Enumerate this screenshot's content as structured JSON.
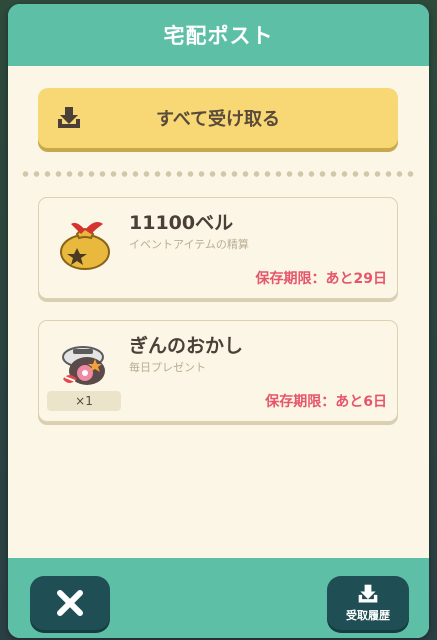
{
  "header": {
    "title": "宅配ポスト"
  },
  "receive_all": {
    "label": "すべて受け取る",
    "icon": "download-tray-icon"
  },
  "items": [
    {
      "name": "11100ベル",
      "subtitle": "イベントアイテムの精算",
      "expiry": "保存期限：あと29日",
      "icon": "bell-bag-icon"
    },
    {
      "name": "ぎんのおかし",
      "subtitle": "毎日プレゼント",
      "expiry": "保存期限：あと6日",
      "quantity": "×1",
      "icon": "silver-candy-tin-icon"
    }
  ],
  "footer": {
    "close_icon": "close-icon",
    "history_label": "受取履歴",
    "history_icon": "download-tray-icon"
  },
  "colors": {
    "header": "#5dbfa6",
    "button": "#f8d874",
    "expiry": "#e6566a",
    "footer_btn": "#1f4f55"
  }
}
